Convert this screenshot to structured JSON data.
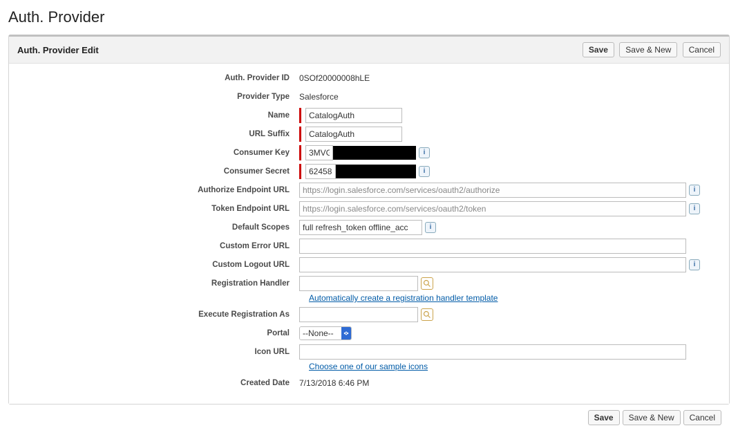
{
  "page_title": "Auth. Provider",
  "panel_title": "Auth. Provider Edit",
  "buttons": {
    "save": "Save",
    "save_new": "Save & New",
    "cancel": "Cancel"
  },
  "fields": {
    "auth_provider_id": {
      "label": "Auth. Provider ID",
      "value": "0SOf20000008hLE"
    },
    "provider_type": {
      "label": "Provider Type",
      "value": "Salesforce"
    },
    "name": {
      "label": "Name",
      "value": "CatalogAuth"
    },
    "url_suffix": {
      "label": "URL Suffix",
      "value": "CatalogAuth"
    },
    "consumer_key": {
      "label": "Consumer Key",
      "value": "3MVG"
    },
    "consumer_secret": {
      "label": "Consumer Secret",
      "value": "62458"
    },
    "authorize_url": {
      "label": "Authorize Endpoint URL",
      "value": "https://login.salesforce.com/services/oauth2/authorize"
    },
    "token_url": {
      "label": "Token Endpoint URL",
      "value": "https://login.salesforce.com/services/oauth2/token"
    },
    "default_scopes": {
      "label": "Default Scopes",
      "value": "full refresh_token offline_acc"
    },
    "custom_error_url": {
      "label": "Custom Error URL",
      "value": ""
    },
    "custom_logout_url": {
      "label": "Custom Logout URL",
      "value": ""
    },
    "registration_handler": {
      "label": "Registration Handler",
      "value": "",
      "help_link": "Automatically create a registration handler template"
    },
    "execute_registration_as": {
      "label": "Execute Registration As",
      "value": ""
    },
    "portal": {
      "label": "Portal",
      "value": "--None--"
    },
    "icon_url": {
      "label": "Icon URL",
      "value": "",
      "help_link": "Choose one of our sample icons"
    },
    "created_date": {
      "label": "Created Date",
      "value": "7/13/2018 6:46 PM"
    }
  }
}
